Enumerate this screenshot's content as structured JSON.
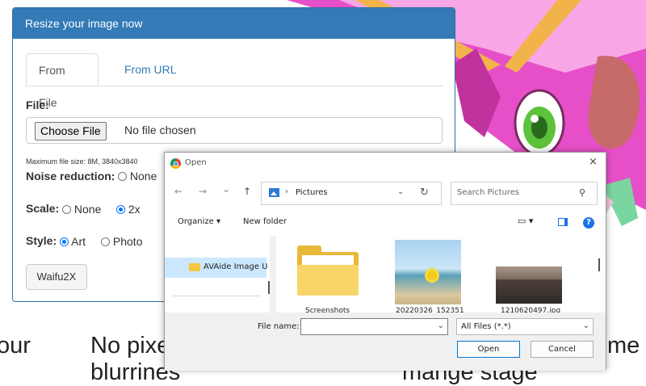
{
  "panel": {
    "title": "Resize your image now",
    "tabs": [
      {
        "label": "From File",
        "active": true
      },
      {
        "label": "From URL",
        "active": false
      }
    ],
    "file_label": "File:",
    "choose_button": "Choose File",
    "no_file_text": "No file chosen",
    "max_size_note": "Maximum file size: 8M, 3840x3840",
    "noise_label": "Noise reduction:",
    "noise_options": [
      {
        "label": "None",
        "selected": false
      }
    ],
    "scale_label": "Scale:",
    "scale_options": [
      {
        "label": "None",
        "selected": false
      },
      {
        "label": "2x",
        "selected": true
      }
    ],
    "style_label": "Style:",
    "style_options": [
      {
        "label": "Art",
        "selected": true
      },
      {
        "label": "Photo",
        "selected": false
      }
    ],
    "submit_button": "Waifu2X"
  },
  "page_text": {
    "left_fragment": "our",
    "middle_fragment": "No pixe",
    "middle_fragment_line2": "blurrines",
    "right_fragment": "me a",
    "right_fragment_line2": "mange stage"
  },
  "dialog": {
    "title": "Open",
    "close_icon": "×",
    "nav": {
      "back": "←",
      "forward": "→",
      "recent": "⌄",
      "up": "↑"
    },
    "address": {
      "separator": "›",
      "path": "Pictures",
      "dropdown": "⌄",
      "refresh": "↻"
    },
    "search_placeholder": "Search Pictures",
    "search_icon": "⚲",
    "organize_label": "Organize ▾",
    "new_folder_label": "New folder",
    "view_icon": "▭ ▾",
    "help_icon": "?",
    "sidebar_item": "AVAide Image U",
    "files": [
      {
        "name": "Screenshots",
        "kind": "folder"
      },
      {
        "name": "20220326_152351",
        "kind": "image"
      },
      {
        "name": "1210620497.jpg",
        "kind": "image"
      }
    ],
    "filename_label": "File name:",
    "filename_value": "",
    "filter_value": "All Files (*.*)",
    "open_button": "Open",
    "cancel_button": "Cancel"
  },
  "colors": {
    "panel_header": "#337ab7",
    "link": "#337ab7",
    "radio_accent": "#0075ff",
    "selection": "#cce8ff"
  }
}
